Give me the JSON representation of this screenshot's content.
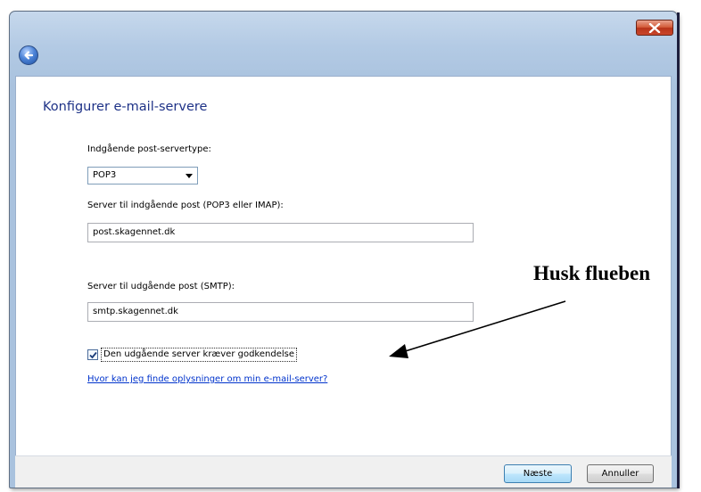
{
  "window": {
    "close_icon": "close-icon",
    "back_icon": "back-arrow-icon"
  },
  "page": {
    "title": "Konfigurer e-mail-servere",
    "incoming_type_label": "Indgående post-servertype:",
    "incoming_type_value": "POP3",
    "incoming_server_label": "Server til indgående post (POP3 eller IMAP):",
    "incoming_server_value": "post.skagennet.dk",
    "outgoing_server_label": "Server til udgående post (SMTP):",
    "outgoing_server_value": "smtp.skagennet.dk",
    "auth_checkbox_label": "Den udgående server kræver godkendelse",
    "auth_checkbox_checked": true,
    "help_link": "Hvor kan jeg finde oplysninger om min e-mail-server?"
  },
  "footer": {
    "next_label": "Næste",
    "cancel_label": "Annuller"
  },
  "annotation": {
    "text": "Husk flueben"
  },
  "colors": {
    "title": "#1e3287",
    "link": "#0033cc",
    "chrome": "#b3cae4",
    "close_button": "#c9462a"
  }
}
